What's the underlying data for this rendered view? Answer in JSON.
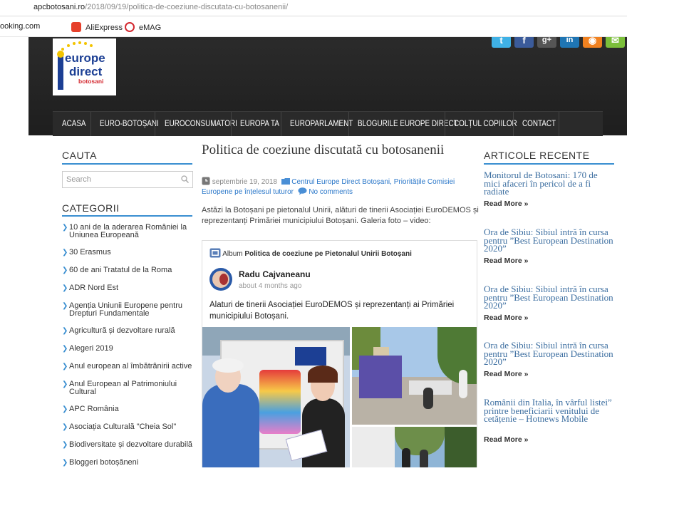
{
  "browser": {
    "url_host": "apcbotosani.ro",
    "url_path": "/2018/09/19/politica-de-coeziune-discutata-cu-botosanenii/",
    "bookmarks": [
      "ooking.com",
      "AliExpress",
      "eMAG"
    ]
  },
  "colors": {
    "accent": "#3a8fd1",
    "link": "#2a77c9",
    "header_bg": "#222222"
  },
  "header": {
    "logo_text": [
      "europe",
      "direct",
      "botosani"
    ],
    "social_icons": [
      "twitter-icon",
      "facebook-icon",
      "google-plus-icon",
      "linkedin-icon",
      "rss-icon",
      "email-icon"
    ]
  },
  "nav": {
    "items": [
      "ACASA",
      "EURO-BOTOȘANI",
      "EUROCONSUMATORI",
      "EUROPA TA",
      "EUROPARLAMENT",
      "BLOGURILE EUROPE DIRECT",
      "COLȚUL COPIILOR",
      "CONTACT"
    ]
  },
  "left_sidebar": {
    "search_title": "CAUTA",
    "search_placeholder": "Search",
    "categories_title": "CATEGORII",
    "categories": [
      "10 ani de la aderarea României la Uniunea Europeană",
      "30 Erasmus",
      "60 de ani Tratatul de la Roma",
      "ADR Nord Est",
      "Agenția Uniunii Europene pentru Drepturi Fundamentale",
      "Agricultură și dezvoltare rurală",
      "Alegeri 2019",
      "Anul european al îmbătrânirii active",
      "Anul European al Patrimoniului Cultural",
      "APC România",
      "Asociația Culturală \"Cheia Sol\"",
      "Biodiversitate și dezvoltare durabilă",
      "Bloggeri botoșăneni"
    ]
  },
  "post": {
    "title": "Politica de coeziune discutată cu botosanenii",
    "date": "septembrie 19, 2018",
    "categories_text": "Centrul Europe Direct Botoșani, Prioritățile Comisiei Europene pe înțelesul tuturor",
    "comments": "No comments",
    "intro": "Astăzi la Botoșani pe pietonalul Unirii, alături de tinerii Asociației EuroDEMOS și reprezentanți Primăriei municipiului Botoșani. Galeria foto – video:"
  },
  "album": {
    "label": "Album",
    "title": "Politica de coeziune pe Pietonalul Unirii Botoșani",
    "author": "Radu Cajvaneanu",
    "time": "about 4 months ago",
    "text": "Alaturi de tinerii Asociației EuroDEMOS și reprezentanți ai Primăriei municipiului Botoșani."
  },
  "right_sidebar": {
    "title": "ARTICOLE RECENTE",
    "read_more": "Read More »",
    "articles": [
      "Monitorul de Botosani: 170 de mici afaceri în pericol de a fi radiate",
      "Ora de Sibiu: Sibiul intră în cursa pentru ”Best European Destination 2020”",
      "Ora de Sibiu: Sibiul intră în cursa pentru ”Best European Destination 2020”",
      "Ora de Sibiu: Sibiul intră în cursa pentru ”Best European Destination 2020”",
      "Românii din Italia, în vârful listei” printre beneficiarii venitului de cetățenie – Hotnews Mobile"
    ]
  }
}
